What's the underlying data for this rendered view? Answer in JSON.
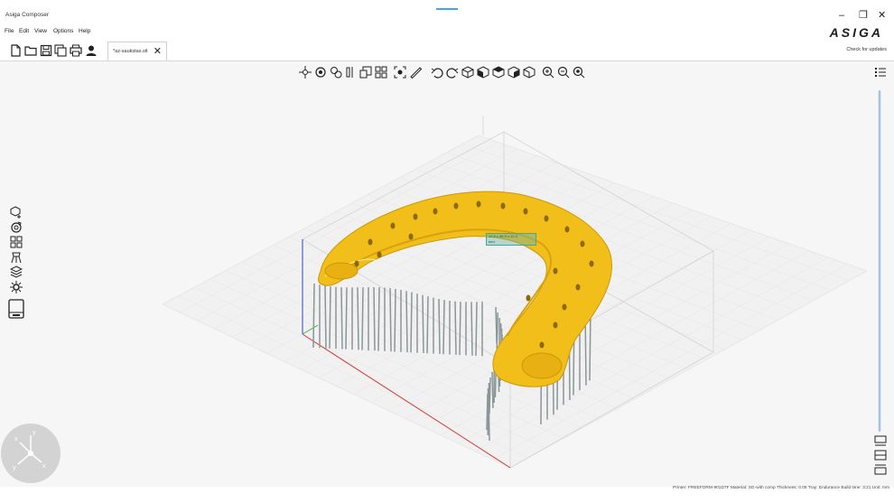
{
  "window": {
    "title": "Asiga Composer",
    "brand": "ASIGA"
  },
  "menu": [
    "File",
    "Edit",
    "View",
    "Options",
    "Help"
  ],
  "tab": {
    "label": "*az-saukstas.stl"
  },
  "header": {
    "check_updates": "Check for updates"
  },
  "status": {
    "text": "Printer: FREEFORM-901D7F  Material: SG-with comp  Thickness: 0.05  Tray: Endurance  Build time: 3:21  Unit: mm"
  },
  "readout": {
    "lines": [
      "12.5 x 45.0 x 12.3",
      "mm"
    ]
  },
  "colors": {
    "accent": "#4aa3df",
    "model": "#f2be1a",
    "support": "#8a9598",
    "axis_x": "#d83a3a",
    "axis_y": "#2d3fcf",
    "axis_z": "#3bb34a"
  },
  "icons": {
    "file_toolbar": [
      "new-file-icon",
      "open-folder-icon",
      "save-icon",
      "save-as-icon",
      "print-icon",
      "user-icon"
    ],
    "view_toolbar": [
      "move-icon",
      "rotate-icon",
      "scale-icon",
      "mirror-icon",
      "duplicate-icon",
      "arrange-icon",
      "fit-view-icon",
      "measure-icon",
      "undo-icon",
      "redo-icon",
      "view-iso-icon",
      "view-front-icon",
      "view-top-icon",
      "view-side-icon",
      "view-back-icon",
      "zoom-in-icon",
      "zoom-out-icon",
      "zoom-fit-icon"
    ],
    "side_toolbar": [
      "add-model-icon",
      "orient-icon",
      "layout-icon",
      "supports-icon",
      "slice-layers-icon",
      "settings-icon",
      "printer-icon"
    ],
    "right_toolbar": [
      "list-icon",
      "bottom-view-icon",
      "split-view-icon",
      "top-view-icon"
    ]
  }
}
